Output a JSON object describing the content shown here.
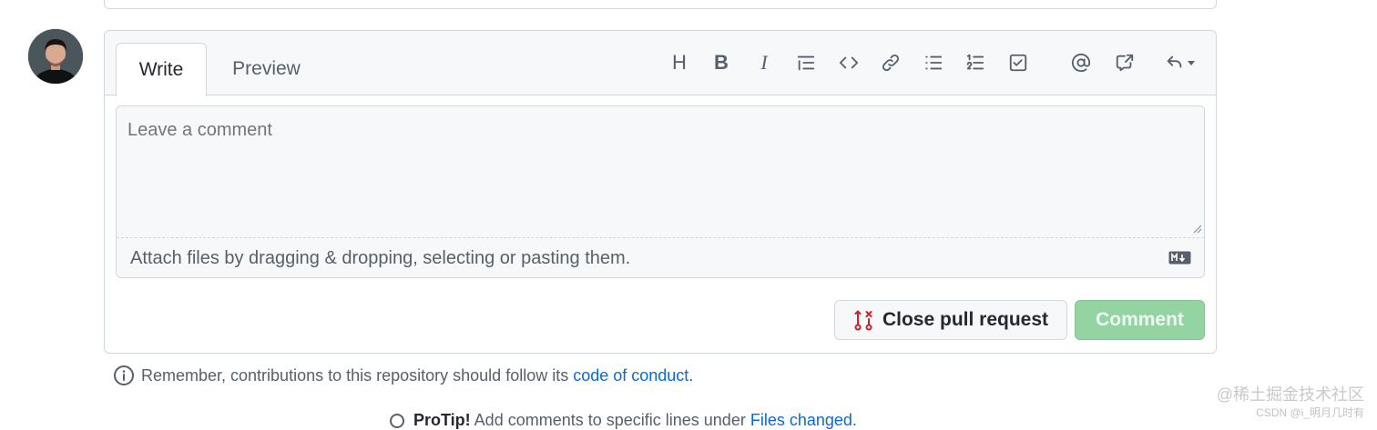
{
  "editor": {
    "tabs": {
      "write": "Write",
      "preview": "Preview"
    },
    "toolbar": [
      {
        "name": "heading",
        "icon": "heading-icon",
        "label": "H"
      },
      {
        "name": "bold",
        "icon": "bold-icon",
        "label": "B"
      },
      {
        "name": "italic",
        "icon": "italic-icon",
        "label": "I"
      },
      {
        "name": "quote",
        "icon": "quote-icon"
      },
      {
        "name": "code",
        "icon": "code-icon"
      },
      {
        "name": "link",
        "icon": "link-icon"
      },
      {
        "name": "unordered-list",
        "icon": "list-unordered-icon"
      },
      {
        "name": "ordered-list",
        "icon": "list-ordered-icon"
      },
      {
        "name": "task-list",
        "icon": "tasklist-icon"
      },
      {
        "name": "mention",
        "icon": "mention-icon"
      },
      {
        "name": "cross-reference",
        "icon": "cross-reference-icon"
      },
      {
        "name": "saved-replies",
        "icon": "reply-icon"
      }
    ],
    "textarea": {
      "placeholder": "Leave a comment",
      "value": ""
    },
    "attach_text": "Attach files by dragging & dropping, selecting or pasting them.",
    "markdown_icon": "markdown-icon"
  },
  "actions": {
    "close_label": "Close pull request",
    "comment_label": "Comment",
    "close_icon_color": "#cf222e",
    "comment_bg_color": "#94d3a2"
  },
  "reminder": {
    "text": "Remember, contributions to this repository should follow its ",
    "link": "code of conduct",
    "end": "."
  },
  "protip": {
    "label": "ProTip!",
    "text": " Add comments to specific lines under ",
    "link": "Files changed",
    "end": "."
  },
  "watermark": {
    "line1": "@稀土掘金技术社区",
    "line2": "CSDN @i_明月几时有"
  }
}
